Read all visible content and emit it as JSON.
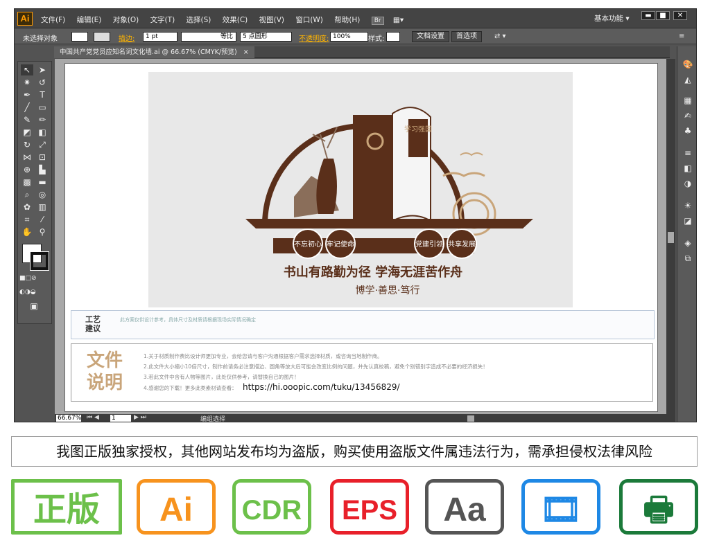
{
  "window": {
    "app_logo": "Ai",
    "menus": [
      "文件(F)",
      "编辑(E)",
      "对象(O)",
      "文字(T)",
      "选择(S)",
      "效果(C)",
      "视图(V)",
      "窗口(W)",
      "帮助(H)"
    ],
    "br_badge": "Br",
    "workspace": "基本功能",
    "min_btn": "▬",
    "max_btn": "■",
    "close_btn": "✕"
  },
  "control_bar": {
    "selection_status": "未选择对象",
    "stroke_label": "描边:",
    "stroke_weight": "1 pt",
    "stroke_profile": "等比",
    "brush": "5 点圆形",
    "opacity_label": "不透明度:",
    "opacity_value": "100%",
    "style_label": "样式:",
    "doc_setup_btn": "文档设置",
    "prefs_btn": "首选项"
  },
  "document_tab": {
    "title": "中国共产党党员应知名词文化墙.ai @ 66.67% (CMYK/预览)",
    "close": "×"
  },
  "artwork": {
    "badges": [
      "不忘初心",
      "牢记使命",
      "党建引领",
      "共享发展"
    ],
    "study_tag": "学习强国",
    "headline": "书山有路勤为径  学海无涯苦作舟",
    "subline": "博学·善思·笃行"
  },
  "craft": {
    "title_a": "工艺",
    "title_b": "建议",
    "note": "此方案仅供设计参考，具体尺寸及材质请根据现场实际情况确定"
  },
  "doc_notes": {
    "title_a": "文件",
    "title_b": "说明",
    "lines": [
      "1.关于材质制作费比设计师更加专业，会给您请与客户沟通根据客户需求选择材质，或咨询当地制作商。",
      "2.此文件大小缩小10倍尺寸，制作前请务必注意描边、圆角等放大后可能会改变比例的问题，并先认真校稿，避免个别错别字造成不必要的经济损失！",
      "3.若此文件中含有人物等图片，此处仅供参考，请替换自己的图片！",
      "4.感谢您的下载！更多此类素材请查看："
    ],
    "url": "https://hi.ooopic.com/tuku/13456829/"
  },
  "status_bar": {
    "zoom": "66.67%",
    "page": "1",
    "mode": "编组选择"
  },
  "notice": "我图正版独家授权，其他网站发布均为盗版，购买使用盗版文件属违法行为，需承担侵权法律风险",
  "formats": [
    {
      "label": "正版",
      "color": "#6cc04a"
    },
    {
      "label": "Ai",
      "color": "#f7931e"
    },
    {
      "label": "CDR",
      "color": "#6cc04a"
    },
    {
      "label": "EPS",
      "color": "#e8202a"
    },
    {
      "label": "Aa",
      "color": "#555555"
    },
    {
      "label": "",
      "color": "#1e88e5"
    },
    {
      "label": "",
      "color": "#1b7a3a"
    }
  ],
  "colors": {
    "brand_brown": "#5a2f1a",
    "accent_tan": "#c9a57a",
    "party_red": "#c0392b"
  }
}
